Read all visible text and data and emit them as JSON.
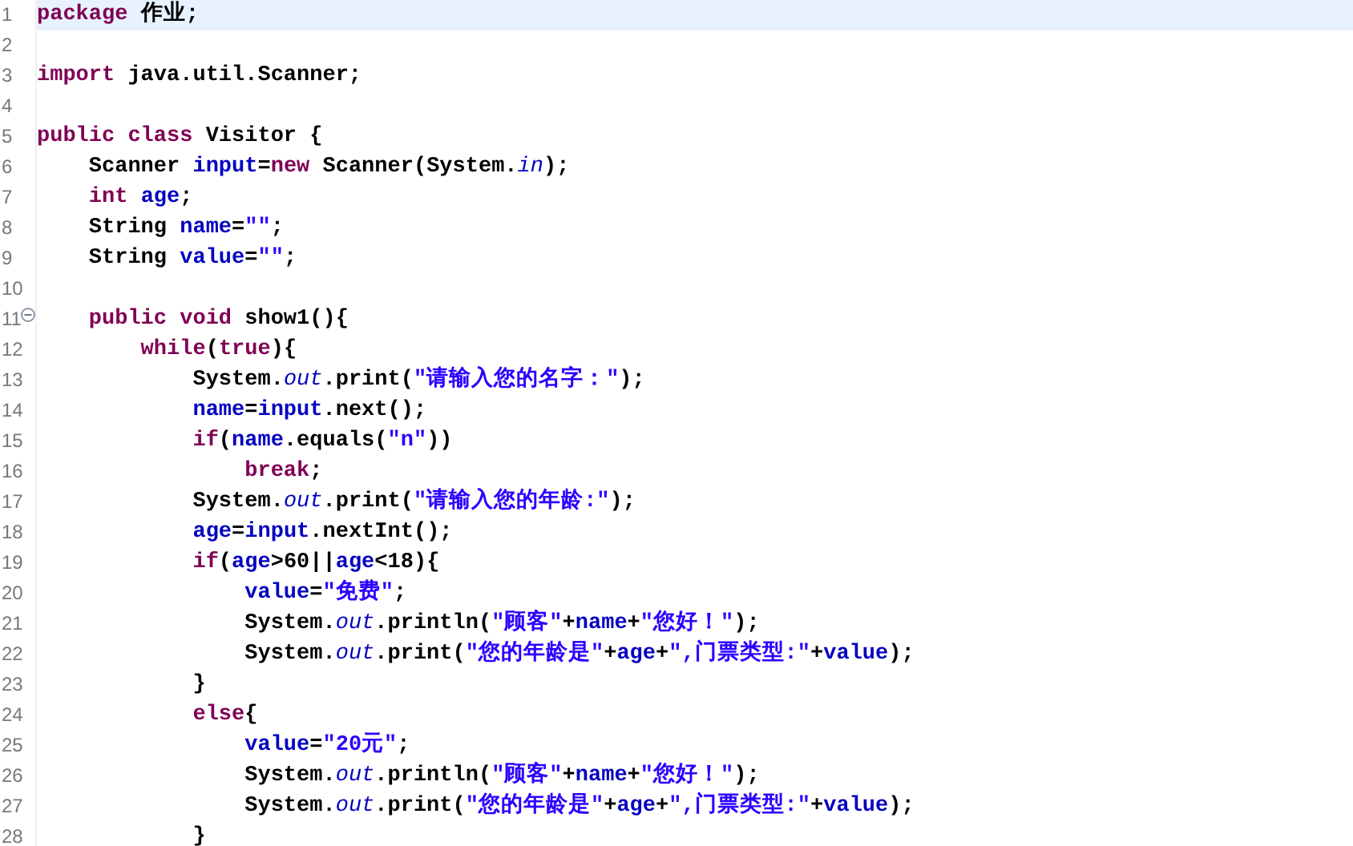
{
  "lines": [
    {
      "number": "1",
      "current": true,
      "tokens": [
        {
          "kind": "kw",
          "text": "package"
        },
        {
          "kind": "plain",
          "text": " 作业;"
        }
      ]
    },
    {
      "number": "2",
      "current": false
    },
    {
      "number": "3",
      "current": false,
      "tokens": [
        {
          "kind": "kw",
          "text": "import"
        },
        {
          "kind": "plain",
          "text": " java.util.Scanner;"
        }
      ]
    },
    {
      "number": "4",
      "current": false
    },
    {
      "number": "5",
      "current": false,
      "tokens": [
        {
          "kind": "kw",
          "text": "public class"
        },
        {
          "kind": "plain",
          "text": " Visitor {"
        }
      ]
    },
    {
      "number": "6",
      "current": false,
      "tokens": [
        {
          "kind": "plain",
          "text": "    Scanner "
        },
        {
          "kind": "field",
          "text": "input"
        },
        {
          "kind": "plain",
          "text": "="
        },
        {
          "kind": "kw",
          "text": "new"
        },
        {
          "kind": "plain",
          "text": " Scanner(System."
        },
        {
          "kind": "static",
          "text": "in"
        },
        {
          "kind": "plain",
          "text": ");"
        }
      ]
    },
    {
      "number": "7",
      "current": false,
      "tokens": [
        {
          "kind": "kw",
          "text": "    int"
        },
        {
          "kind": "field",
          "text": " age"
        },
        {
          "kind": "plain",
          "text": ";"
        }
      ]
    },
    {
      "number": "8",
      "current": false,
      "tokens": [
        {
          "kind": "plain",
          "text": "    String "
        },
        {
          "kind": "field",
          "text": "name"
        },
        {
          "kind": "plain",
          "text": "="
        },
        {
          "kind": "str",
          "text": "\"\""
        },
        {
          "kind": "plain",
          "text": ";"
        }
      ]
    },
    {
      "number": "9",
      "current": false,
      "tokens": [
        {
          "kind": "plain",
          "text": "    String "
        },
        {
          "kind": "field",
          "text": "value"
        },
        {
          "kind": "plain",
          "text": "="
        },
        {
          "kind": "str",
          "text": "\"\""
        },
        {
          "kind": "plain",
          "text": ";"
        }
      ]
    },
    {
      "number": "10",
      "current": false
    },
    {
      "number": "11",
      "current": false,
      "fold": true,
      "tokens": [
        {
          "kind": "kw",
          "text": "    public void"
        },
        {
          "kind": "plain",
          "text": " show1(){"
        }
      ]
    },
    {
      "number": "12",
      "current": false,
      "tokens": [
        {
          "kind": "kw",
          "text": "        while"
        },
        {
          "kind": "plain",
          "text": "("
        },
        {
          "kind": "kw",
          "text": "true"
        },
        {
          "kind": "plain",
          "text": "){"
        }
      ]
    },
    {
      "number": "13",
      "current": false,
      "tokens": [
        {
          "kind": "plain",
          "text": "            System."
        },
        {
          "kind": "static",
          "text": "out"
        },
        {
          "kind": "plain",
          "text": ".print("
        },
        {
          "kind": "str",
          "text": "\"请输入您的名字：\""
        },
        {
          "kind": "plain",
          "text": ");"
        }
      ]
    },
    {
      "number": "14",
      "current": false,
      "tokens": [
        {
          "kind": "field",
          "text": "            name"
        },
        {
          "kind": "plain",
          "text": "="
        },
        {
          "kind": "field",
          "text": "input"
        },
        {
          "kind": "plain",
          "text": ".next();"
        }
      ]
    },
    {
      "number": "15",
      "current": false,
      "tokens": [
        {
          "kind": "kw",
          "text": "            if"
        },
        {
          "kind": "plain",
          "text": "("
        },
        {
          "kind": "field",
          "text": "name"
        },
        {
          "kind": "plain",
          "text": ".equals("
        },
        {
          "kind": "str",
          "text": "\"n\""
        },
        {
          "kind": "plain",
          "text": "))"
        }
      ]
    },
    {
      "number": "16",
      "current": false,
      "tokens": [
        {
          "kind": "kw",
          "text": "                break"
        },
        {
          "kind": "plain",
          "text": ";"
        }
      ]
    },
    {
      "number": "17",
      "current": false,
      "tokens": [
        {
          "kind": "plain",
          "text": "            System."
        },
        {
          "kind": "static",
          "text": "out"
        },
        {
          "kind": "plain",
          "text": ".print("
        },
        {
          "kind": "str",
          "text": "\"请输入您的年龄:\""
        },
        {
          "kind": "plain",
          "text": ");"
        }
      ]
    },
    {
      "number": "18",
      "current": false,
      "tokens": [
        {
          "kind": "field",
          "text": "            age"
        },
        {
          "kind": "plain",
          "text": "="
        },
        {
          "kind": "field",
          "text": "input"
        },
        {
          "kind": "plain",
          "text": ".nextInt();"
        }
      ]
    },
    {
      "number": "19",
      "current": false,
      "tokens": [
        {
          "kind": "kw",
          "text": "            if"
        },
        {
          "kind": "plain",
          "text": "("
        },
        {
          "kind": "field",
          "text": "age"
        },
        {
          "kind": "plain",
          "text": ">60||"
        },
        {
          "kind": "field",
          "text": "age"
        },
        {
          "kind": "plain",
          "text": "<18){"
        }
      ]
    },
    {
      "number": "20",
      "current": false,
      "tokens": [
        {
          "kind": "field",
          "text": "                value"
        },
        {
          "kind": "plain",
          "text": "="
        },
        {
          "kind": "str",
          "text": "\"免费\""
        },
        {
          "kind": "plain",
          "text": ";"
        }
      ]
    },
    {
      "number": "21",
      "current": false,
      "tokens": [
        {
          "kind": "plain",
          "text": "                System."
        },
        {
          "kind": "static",
          "text": "out"
        },
        {
          "kind": "plain",
          "text": ".println("
        },
        {
          "kind": "str",
          "text": "\"顾客\""
        },
        {
          "kind": "plain",
          "text": "+"
        },
        {
          "kind": "field",
          "text": "name"
        },
        {
          "kind": "plain",
          "text": "+"
        },
        {
          "kind": "str",
          "text": "\"您好！\""
        },
        {
          "kind": "plain",
          "text": ");"
        }
      ]
    },
    {
      "number": "22",
      "current": false,
      "tokens": [
        {
          "kind": "plain",
          "text": "                System."
        },
        {
          "kind": "static",
          "text": "out"
        },
        {
          "kind": "plain",
          "text": ".print("
        },
        {
          "kind": "str",
          "text": "\"您的年龄是\""
        },
        {
          "kind": "plain",
          "text": "+"
        },
        {
          "kind": "field",
          "text": "age"
        },
        {
          "kind": "plain",
          "text": "+"
        },
        {
          "kind": "str",
          "text": "\",门票类型:\""
        },
        {
          "kind": "plain",
          "text": "+"
        },
        {
          "kind": "field",
          "text": "value"
        },
        {
          "kind": "plain",
          "text": ");"
        }
      ]
    },
    {
      "number": "23",
      "current": false,
      "tokens": [
        {
          "kind": "plain",
          "text": "            }"
        }
      ]
    },
    {
      "number": "24",
      "current": false,
      "tokens": [
        {
          "kind": "kw",
          "text": "            else"
        },
        {
          "kind": "plain",
          "text": "{"
        }
      ]
    },
    {
      "number": "25",
      "current": false,
      "tokens": [
        {
          "kind": "field",
          "text": "                value"
        },
        {
          "kind": "plain",
          "text": "="
        },
        {
          "kind": "str",
          "text": "\"20元\""
        },
        {
          "kind": "plain",
          "text": ";"
        }
      ]
    },
    {
      "number": "26",
      "current": false,
      "tokens": [
        {
          "kind": "plain",
          "text": "                System."
        },
        {
          "kind": "static",
          "text": "out"
        },
        {
          "kind": "plain",
          "text": ".println("
        },
        {
          "kind": "str",
          "text": "\"顾客\""
        },
        {
          "kind": "plain",
          "text": "+"
        },
        {
          "kind": "field",
          "text": "name"
        },
        {
          "kind": "plain",
          "text": "+"
        },
        {
          "kind": "str",
          "text": "\"您好！\""
        },
        {
          "kind": "plain",
          "text": ");"
        }
      ]
    },
    {
      "number": "27",
      "current": false,
      "tokens": [
        {
          "kind": "plain",
          "text": "                System."
        },
        {
          "kind": "static",
          "text": "out"
        },
        {
          "kind": "plain",
          "text": ".print("
        },
        {
          "kind": "str",
          "text": "\"您的年龄是\""
        },
        {
          "kind": "plain",
          "text": "+"
        },
        {
          "kind": "field",
          "text": "age"
        },
        {
          "kind": "plain",
          "text": "+"
        },
        {
          "kind": "str",
          "text": "\",门票类型:\""
        },
        {
          "kind": "plain",
          "text": "+"
        },
        {
          "kind": "field",
          "text": "value"
        },
        {
          "kind": "plain",
          "text": ");"
        }
      ]
    },
    {
      "number": "28",
      "current": false,
      "tokens": [
        {
          "kind": "plain",
          "text": "            }"
        }
      ]
    }
  ]
}
